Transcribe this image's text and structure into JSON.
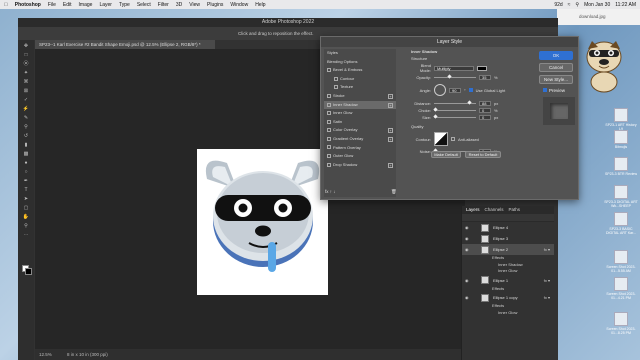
{
  "menubar": {
    "items": [
      "Photoshop",
      "File",
      "Edit",
      "Image",
      "Layer",
      "Type",
      "Select",
      "Filter",
      "3D",
      "View",
      "Plugins",
      "Window",
      "Help"
    ],
    "right": [
      "92d",
      "Mon Jan 30",
      "11:22 AM"
    ]
  },
  "ps": {
    "title": "Adobe Photoshop 2022",
    "options_hint": "Click and drag to reposition the effect.",
    "doc_tab": "SP23--1 Karl Exercise #2 Bandit Shape Emoji.psd @ 12.5% (Ellipse 2, RGB/8*) *",
    "zoom": "12.5%",
    "doc_info": "8 in x 10 in (300 ppi)"
  },
  "dialog": {
    "title": "Layer Style",
    "styles_header": "Styles",
    "styles": [
      {
        "label": "Blending Options",
        "check": false,
        "plus": false,
        "indent": false,
        "sel": false
      },
      {
        "label": "Bevel & Emboss",
        "check": true,
        "plus": false,
        "indent": false,
        "sel": false
      },
      {
        "label": "Contour",
        "check": true,
        "plus": false,
        "indent": true,
        "sel": false
      },
      {
        "label": "Texture",
        "check": true,
        "plus": false,
        "indent": true,
        "sel": false
      },
      {
        "label": "Stroke",
        "check": true,
        "plus": true,
        "indent": false,
        "sel": false
      },
      {
        "label": "Inner Shadow",
        "check": true,
        "plus": true,
        "indent": false,
        "sel": true
      },
      {
        "label": "Inner Glow",
        "check": true,
        "plus": false,
        "indent": false,
        "sel": false
      },
      {
        "label": "Satin",
        "check": true,
        "plus": false,
        "indent": false,
        "sel": false
      },
      {
        "label": "Color Overlay",
        "check": true,
        "plus": true,
        "indent": false,
        "sel": false
      },
      {
        "label": "Gradient Overlay",
        "check": true,
        "plus": true,
        "indent": false,
        "sel": false
      },
      {
        "label": "Pattern Overlay",
        "check": true,
        "plus": false,
        "indent": false,
        "sel": false
      },
      {
        "label": "Outer Glow",
        "check": true,
        "plus": false,
        "indent": false,
        "sel": false
      },
      {
        "label": "Drop Shadow",
        "check": true,
        "plus": true,
        "indent": false,
        "sel": false
      }
    ],
    "panel": {
      "heading": "Inner Shadow",
      "structure": "Structure",
      "blend_mode_label": "Blend Mode:",
      "blend_mode": "Multiply",
      "opacity_label": "Opacity:",
      "opacity": "35",
      "angle_label": "Angle:",
      "angle": "90",
      "global_light": "Use Global Light",
      "distance_label": "Distance:",
      "distance": "88",
      "choke_label": "Choke:",
      "choke": "0",
      "size_label": "Size:",
      "size": "0",
      "quality": "Quality",
      "contour_label": "Contour:",
      "anti_aliased": "Anti-aliased",
      "noise_label": "Noise:",
      "noise": "0",
      "make_default": "Make Default",
      "reset_default": "Reset to Default"
    },
    "buttons": {
      "ok": "OK",
      "cancel": "Cancel",
      "new_style": "New Style...",
      "preview": "Preview"
    },
    "fx": "fx  ↑  ↓"
  },
  "layers": {
    "tabs": [
      "Layers",
      "Channels",
      "Paths"
    ],
    "rows": [
      {
        "type": "layer",
        "name": "Ellipse 4",
        "sel": false,
        "fx": false
      },
      {
        "type": "layer",
        "name": "Ellipse 3",
        "sel": false,
        "fx": false
      },
      {
        "type": "layer",
        "name": "Ellipse 2",
        "sel": true,
        "fx": true
      },
      {
        "type": "sub",
        "name": "Effects"
      },
      {
        "type": "subdeep",
        "name": "Inner Shadow"
      },
      {
        "type": "subdeep",
        "name": "Inner Glow"
      },
      {
        "type": "layer",
        "name": "Ellipse 1",
        "sel": false,
        "fx": true
      },
      {
        "type": "sub",
        "name": "Effects"
      },
      {
        "type": "layer",
        "name": "Ellipse 1 copy",
        "sel": false,
        "fx": true
      },
      {
        "type": "sub",
        "name": "Effects"
      },
      {
        "type": "subdeep",
        "name": "Inner Glow"
      }
    ]
  },
  "finder": {
    "title": "download.jpg"
  },
  "desktop_icons": [
    {
      "label": "SP23-1 ART History L9"
    },
    {
      "label": "Bitmojis"
    },
    {
      "label": "SP23-3 BTR Review"
    },
    {
      "label": "SP23-3 DIGITAL ART Wk...SHEEP"
    },
    {
      "label": "SP23-3 BASIC DIGITAL ART Kar..."
    },
    {
      "label": "Screen Shot 2023-01...5.55 AM"
    },
    {
      "label": "Screen Shot 2023-01...4.21 PM"
    },
    {
      "label": "Screen Shot 2023-01...8.25 PM"
    }
  ],
  "colors": {
    "accent": "#2f70d2",
    "bg_dark": "#323232",
    "dialog": "#535353",
    "emoji_blue": "#5aa7e6"
  }
}
